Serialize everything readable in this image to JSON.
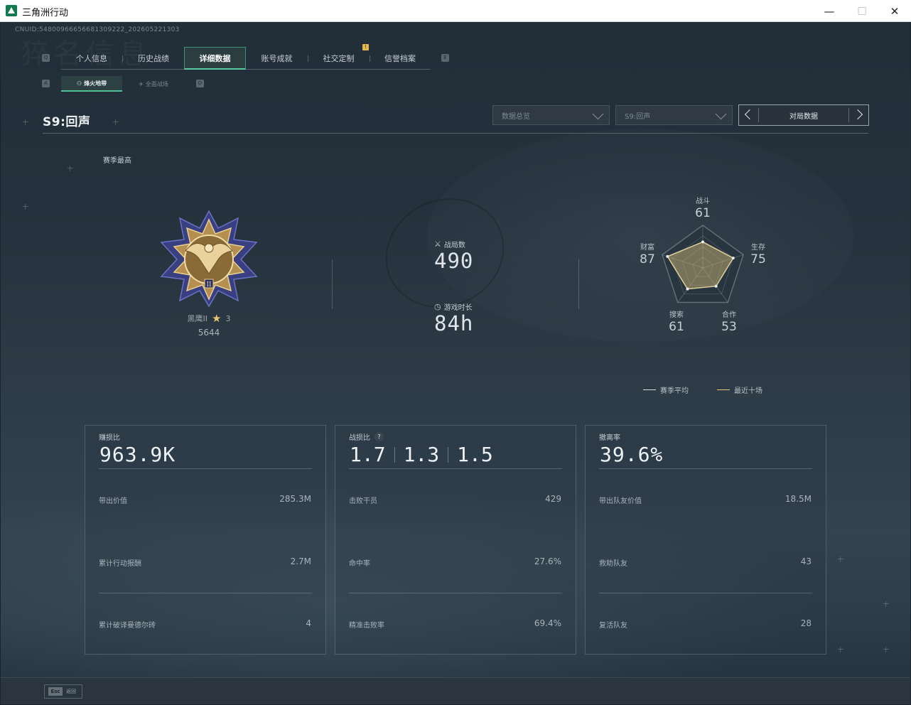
{
  "window": {
    "title": "三角洲行动",
    "minimize": "—",
    "maximize": "☐",
    "close": "✕"
  },
  "uid": "CNUID:548009666566813092​22_202605221303",
  "background_text": "猝名信息",
  "top_tabs": {
    "left_key": "Q",
    "right_key": "E",
    "items": [
      {
        "label": "个人信息",
        "active": false
      },
      {
        "label": "历史战绩",
        "active": false
      },
      {
        "label": "详细数据",
        "active": true
      },
      {
        "label": "账号成就",
        "active": false
      },
      {
        "label": "社交定制",
        "active": false
      },
      {
        "label": "信誉档案",
        "active": false
      }
    ],
    "badge": "!"
  },
  "sub_tabs": {
    "left_key": "A",
    "right_key": "D",
    "items": [
      {
        "label": "烽火地带",
        "active": true
      },
      {
        "label": "全面战场",
        "active": false
      }
    ]
  },
  "season": {
    "title": "S9:回声",
    "best_label": "赛季最高"
  },
  "filters": {
    "data_type": "数据总览",
    "season_select": "S9:回声",
    "match_button": "对局数据"
  },
  "rank": {
    "name": "黑鹰II",
    "stars": "3",
    "score": "5644",
    "badge_numeral": "II"
  },
  "matches": {
    "label": "战局数",
    "value": "490"
  },
  "playtime": {
    "label": "游戏时长",
    "value": "84h"
  },
  "radar": {
    "axes": [
      {
        "label": "战斗",
        "value": 61
      },
      {
        "label": "生存",
        "value": 75
      },
      {
        "label": "合作",
        "value": 53
      },
      {
        "label": "搜索",
        "value": 61
      },
      {
        "label": "财富",
        "value": 87
      }
    ],
    "max": 100,
    "legend": [
      {
        "label": "赛季平均",
        "color": "#d8dde0"
      },
      {
        "label": "最近十场",
        "color": "#e3c77a"
      }
    ]
  },
  "panels": [
    {
      "title": "赚损比",
      "value": "963.9K",
      "rows": [
        {
          "label": "带出价值",
          "value": "285.3M"
        },
        {
          "label": "累计行动报酬",
          "value": "2.7M"
        },
        {
          "label": "累计破译曼德尔砖",
          "value": "4"
        }
      ]
    },
    {
      "title": "战损比",
      "help": "?",
      "values": [
        "1.7",
        "1.3",
        "1.5"
      ],
      "rows": [
        {
          "label": "击败干员",
          "value": "429"
        },
        {
          "label": "命中率",
          "value": "27.6%"
        },
        {
          "label": "精准击败率",
          "value": "69.4%"
        }
      ]
    },
    {
      "title": "撤离率",
      "value": "39.6%",
      "rows": [
        {
          "label": "带出队友价值",
          "value": "18.5M"
        },
        {
          "label": "救助队友",
          "value": "43"
        },
        {
          "label": "复活队友",
          "value": "28"
        }
      ]
    }
  ],
  "footer": {
    "esc_key": "Esc",
    "esc_label": "返回"
  },
  "colors": {
    "accent": "#59c9a2",
    "gold": "#e3c77a",
    "badge": "#e2b84a"
  }
}
